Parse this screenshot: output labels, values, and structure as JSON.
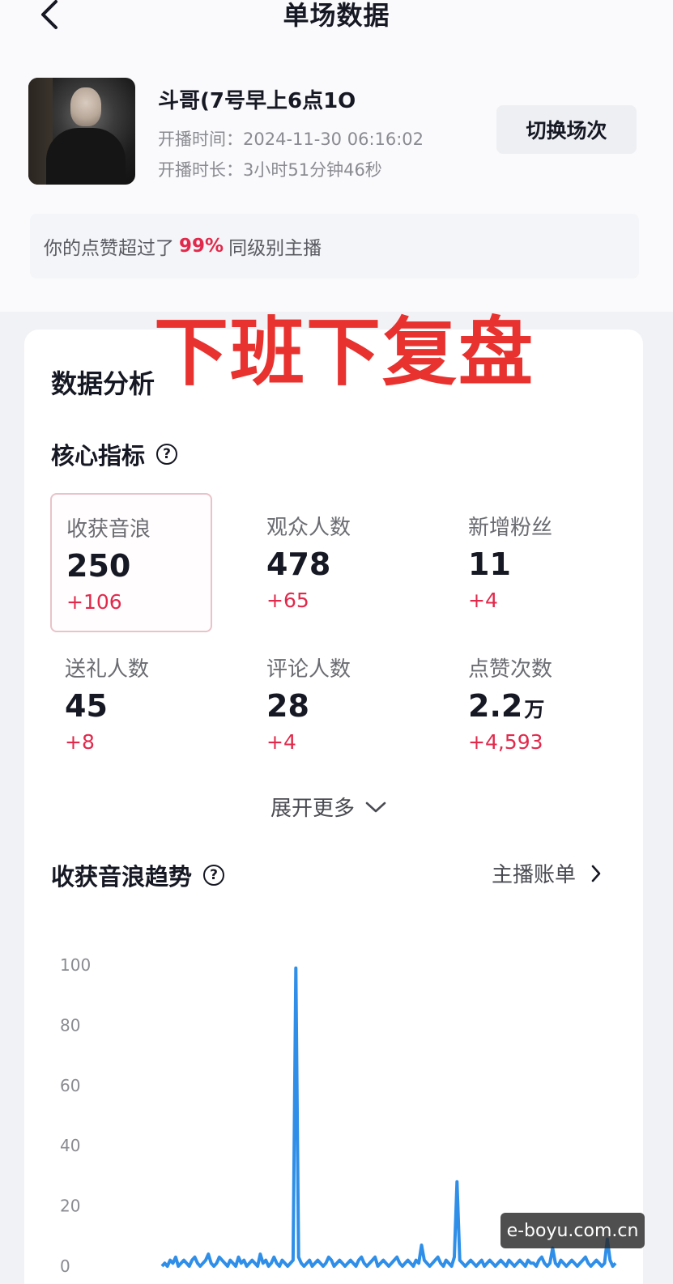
{
  "header": {
    "title": "单场数据",
    "back_icon": "chevron-left-icon"
  },
  "stream": {
    "name": "斗哥(7号早上6点1O",
    "start_time": "开播时间：2024-11-30 06:16:02",
    "duration": "开播时长：3小时51分钟46秒",
    "switch_label": "切换场次"
  },
  "likes_banner": {
    "prefix": "你的点赞超过了",
    "percent": "99%",
    "suffix": "同级别主播",
    "accent_color": "#e2294b"
  },
  "overlay_caption": "下班下复盘",
  "analysis": {
    "title": "数据分析",
    "core_title": "核心指标",
    "help_icon": "question-circle-icon",
    "metrics": [
      {
        "label": "收获音浪",
        "value": "250",
        "unit": "",
        "delta": "+106",
        "selected": true
      },
      {
        "label": "观众人数",
        "value": "478",
        "unit": "",
        "delta": "+65",
        "selected": false
      },
      {
        "label": "新增粉丝",
        "value": "11",
        "unit": "",
        "delta": "+4",
        "selected": false
      },
      {
        "label": "送礼人数",
        "value": "45",
        "unit": "",
        "delta": "+8",
        "selected": false
      },
      {
        "label": "评论人数",
        "value": "28",
        "unit": "",
        "delta": "+4",
        "selected": false
      },
      {
        "label": "点赞次数",
        "value": "2.2",
        "unit": "万",
        "delta": "+4,593",
        "selected": false
      }
    ],
    "expand_label": "展开更多"
  },
  "trend": {
    "title": "收获音浪趋势",
    "bill_label": "主播账单"
  },
  "chart_data": {
    "type": "line",
    "title": "",
    "xlabel": "",
    "ylabel": "",
    "y_ticks": [
      "100",
      "80",
      "60",
      "40",
      "20",
      "0"
    ],
    "ylim": [
      0,
      100
    ],
    "grid": false,
    "color": "#2f8fe8",
    "series": [
      {
        "values": [
          0,
          1,
          0,
          2,
          1,
          3,
          0,
          1,
          2,
          1,
          0,
          2,
          3,
          1,
          0,
          1,
          2,
          4,
          1,
          0,
          1,
          3,
          2,
          1,
          0,
          2,
          1,
          0,
          3,
          1,
          2,
          0,
          1,
          2,
          1,
          0,
          4,
          1,
          2,
          0,
          1,
          3,
          1,
          0,
          2,
          1,
          0,
          1,
          2,
          99,
          3,
          1,
          0,
          1,
          2,
          0,
          1,
          2,
          1,
          0,
          1,
          3,
          2,
          0,
          1,
          2,
          1,
          0,
          1,
          2,
          1,
          0,
          2,
          3,
          1,
          0,
          1,
          2,
          3,
          0,
          1,
          2,
          1,
          0,
          1,
          2,
          3,
          1,
          0,
          1,
          2,
          1,
          0,
          2,
          1,
          7,
          2,
          1,
          0,
          1,
          2,
          3,
          1,
          0,
          2,
          1,
          0,
          3,
          28,
          2,
          1,
          0,
          1,
          2,
          1,
          0,
          1,
          2,
          0,
          1,
          2,
          1,
          0,
          1,
          2,
          1,
          0,
          2,
          1,
          0,
          1,
          2,
          1,
          0,
          2,
          1,
          1,
          0,
          2,
          3,
          1,
          0,
          1,
          6,
          1,
          0,
          2,
          1,
          0,
          1,
          2,
          1,
          0,
          1,
          2,
          3,
          1,
          0,
          1,
          2,
          1,
          0,
          1,
          9,
          2,
          0,
          1
        ]
      }
    ]
  },
  "watermark": "e-boyu.com.cn"
}
